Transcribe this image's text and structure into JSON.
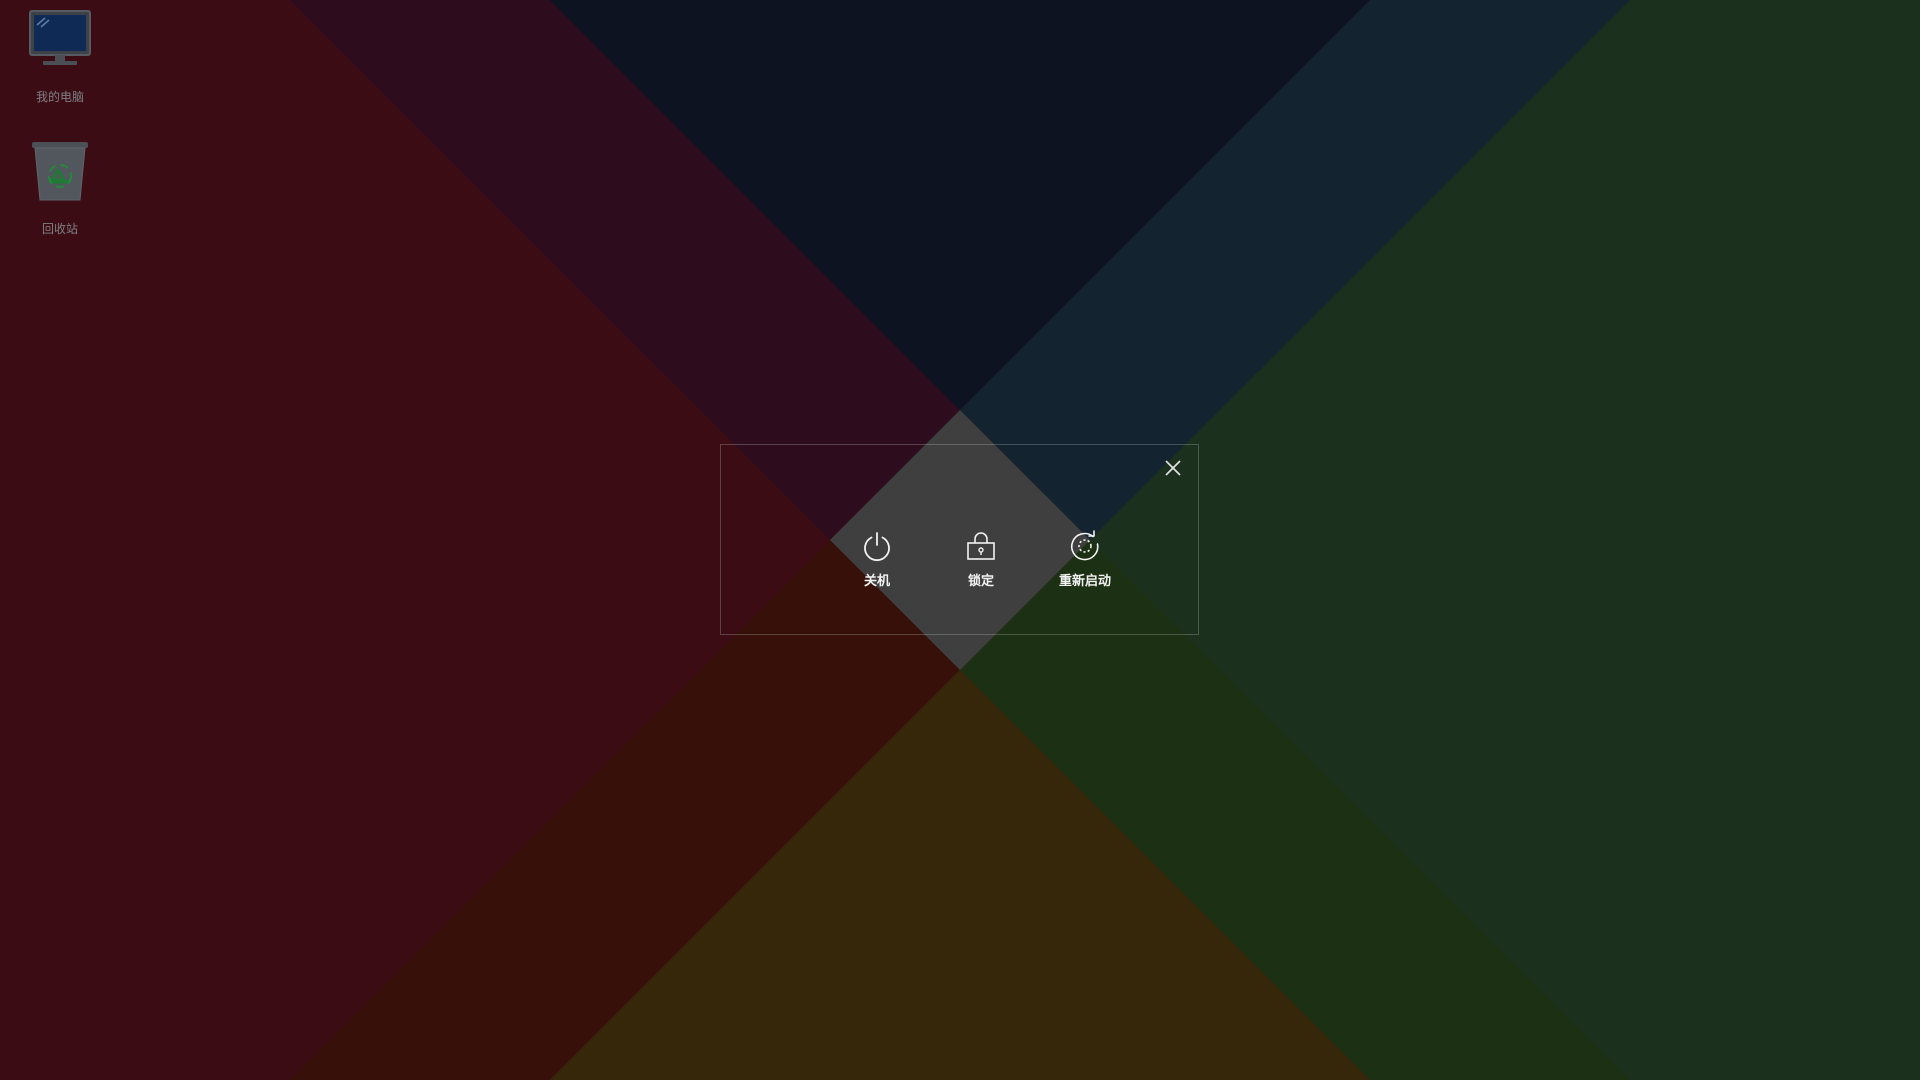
{
  "desktop": {
    "icons": [
      {
        "label": "我的电脑",
        "icon": "computer-monitor-icon"
      },
      {
        "label": "回收站",
        "icon": "recycle-bin-icon"
      }
    ]
  },
  "power_dialog": {
    "close_icon": "close-icon",
    "options": [
      {
        "label": "关机",
        "icon": "power-icon"
      },
      {
        "label": "锁定",
        "icon": "lock-icon"
      },
      {
        "label": "重新启动",
        "icon": "restart-icon"
      }
    ]
  },
  "colors": {
    "wallpaper_red": "#8a1c2c",
    "wallpaper_purple": "#6a1e45",
    "wallpaper_navy": "#1d2a4e",
    "wallpaper_blue": "#284f6c",
    "wallpaper_green": "#3a6c42",
    "wallpaper_orange": "#7a2a16",
    "wallpaper_gold": "#7a5a1c",
    "center_gray": "#8c8c8c"
  }
}
